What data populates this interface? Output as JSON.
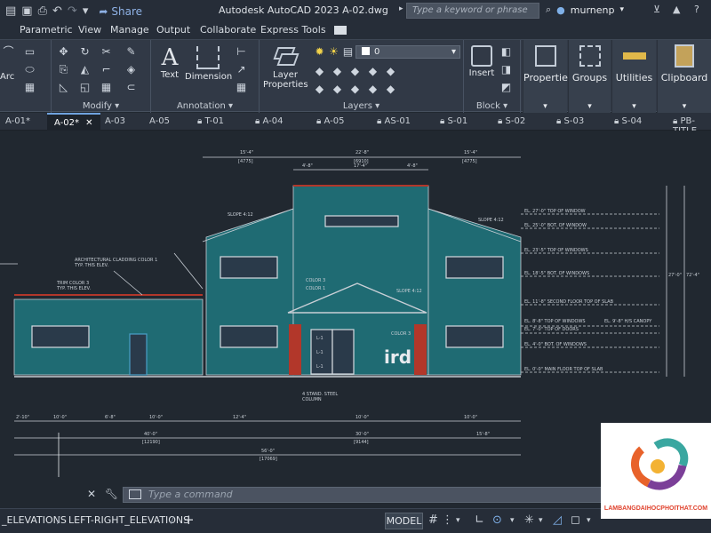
{
  "titlebar": {
    "share_label": "Share",
    "title": "Autodesk AutoCAD 2023   A-02.dwg",
    "search_placeholder": "Type a keyword or phrase",
    "username": "murnenp"
  },
  "menu": [
    "Parametric",
    "View",
    "Manage",
    "Output",
    "Collaborate",
    "Express Tools"
  ],
  "ribbon": {
    "draw_label": "Arc",
    "modify_title": "Modify",
    "text_label": "Text",
    "dimension_label": "Dimension",
    "annotation_title": "Annotation",
    "layer_props_line1": "Layer",
    "layer_props_line2": "Properties",
    "layer_value": "0",
    "layers_title": "Layers",
    "insert_label": "Insert",
    "block_title": "Block",
    "properties_label": "Properties",
    "groups_label": "Groups",
    "utilities_label": "Utilities",
    "clipboard_label": "Clipboard"
  },
  "tabs": [
    {
      "label": "A-01*",
      "locked": false
    },
    {
      "label": "A-02*",
      "locked": false,
      "active": true
    },
    {
      "label": "A-03",
      "locked": false
    },
    {
      "label": "A-05",
      "locked": false
    },
    {
      "label": "T-01",
      "locked": true
    },
    {
      "label": "A-04",
      "locked": true
    },
    {
      "label": "A-05",
      "locked": true
    },
    {
      "label": "AS-01",
      "locked": true
    },
    {
      "label": "S-01",
      "locked": true
    },
    {
      "label": "S-02",
      "locked": true
    },
    {
      "label": "S-03",
      "locked": true
    },
    {
      "label": "S-04",
      "locked": true
    },
    {
      "label": "PB-TITLE",
      "locked": true
    }
  ],
  "drawing": {
    "top_dims": [
      "15'-4\"",
      "22'-8\"",
      "15'-4\""
    ],
    "top_dims_sub": [
      "[4775]",
      "[6910]",
      "[4775]"
    ],
    "mid_dims": [
      "4'-8\"",
      "17'-4\"",
      "4'-8\""
    ],
    "slope_left": "SLOPE 4:12",
    "slope_right": "SLOPE 4:12",
    "slope_center": "SLOPE 4:12",
    "note_cladding": "ARCHITECTURAL CLADDING COLOR 1",
    "note_cladding2": "TYP. THIS ELEV.",
    "note_trim": "TRIM COLOR 3",
    "note_trim2": "TYP. THIS ELEV.",
    "note_color3": "COLOR 3",
    "note_color1": "COLOR 1",
    "note_column": "4 STAND. STEEL COLUMN",
    "brand_text": "ird",
    "levels": [
      "EL. 27'-0\"  TOP OF WINDOW",
      "EL. 25'-0\"  BOT. OF WINDOW",
      "EL. 23'-5\"  TOP OF WINDOWS",
      "EL. 18'-5\"  BOT. OF WINDOWS",
      "EL. 11'-8\"  SECOND FLOOR TOP OF SLAB",
      "EL. 8'-8\"  TOP OF WINDOWS",
      "EL. 7'-0\"  TOP OF DOORS",
      "EL. 4'-0\"  BOT. OF WINDOWS",
      "EL. 0'-0\"  MAIN FLOOR TOP OF SLAB"
    ],
    "canopy_note": "EL. 9'-8\"  H/S CANOPY",
    "bottom_dims": [
      "2'-10\"",
      "10'-0\"",
      "6'-8\"",
      "10'-0\"",
      "12'-4\"",
      "10'-0\"",
      "10'-0\"",
      "15'-8\""
    ],
    "dim_40": "40'-0\"",
    "dim_40_sub": "[12190]",
    "dim_30": "30'-0\"",
    "dim_30_sub": "[9144]",
    "dim_total": "56'-0\"",
    "dim_total_sub": "[17069]",
    "right_dims": [
      "27'-0\"",
      "72'-4\""
    ],
    "door_labels": [
      "L-1",
      "L-1",
      "L-1"
    ]
  },
  "command": {
    "placeholder": "Type a command"
  },
  "layout_tabs": [
    "_ELEVATIONS",
    "LEFT-RIGHT_ELEVATIONS"
  ],
  "status": {
    "model_label": "MODEL"
  },
  "watermark": {
    "text": "LAMBANGDAIHOCPHOITHAT.COM"
  },
  "colors": {
    "cad_bg": "#212830",
    "cladding": "#1f6b73",
    "lines": "#c9cfd6",
    "accent_red": "#b2372a"
  }
}
